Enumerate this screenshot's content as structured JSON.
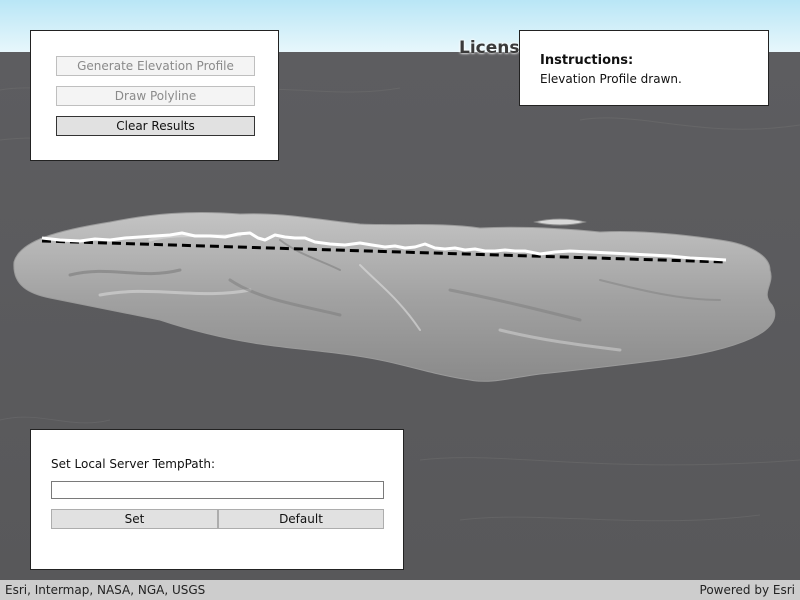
{
  "map": {
    "license_watermark": "License",
    "sky_color": "#cfeef8",
    "ground_color": "#5a5a5c",
    "terrain_color": "#a8a8a8",
    "profile_line_color": "#ffffff",
    "polyline_color": "#000000"
  },
  "toolbar": {
    "generate_label": "Generate Elevation Profile",
    "draw_label": "Draw Polyline",
    "clear_label": "Clear Results"
  },
  "instructions": {
    "title": "Instructions:",
    "message": "Elevation Profile drawn."
  },
  "local_server": {
    "label": "Set Local Server TempPath:",
    "input_value": "",
    "input_placeholder": "",
    "set_label": "Set",
    "default_label": "Default"
  },
  "attribution": {
    "sources": "Esri, Intermap, NASA, NGA, USGS",
    "powered_by": "Powered by Esri"
  }
}
